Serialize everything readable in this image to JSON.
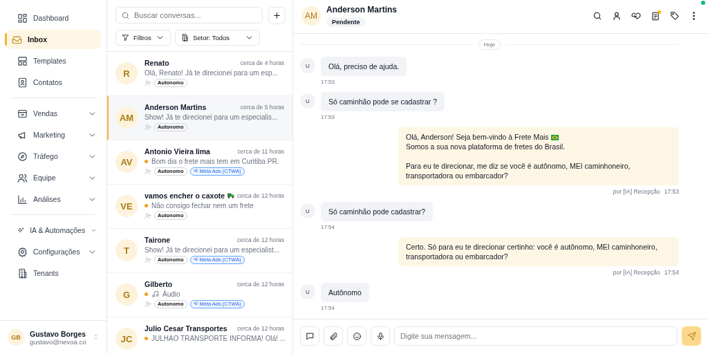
{
  "sidebar": {
    "groups": [
      [
        {
          "label": "Dashboard",
          "expandable": false,
          "selected": false
        },
        {
          "label": "Inbox",
          "expandable": false,
          "selected": true
        },
        {
          "label": "Templates",
          "expandable": false,
          "selected": false
        },
        {
          "label": "Contatos",
          "expandable": false,
          "selected": false
        }
      ],
      [
        {
          "label": "Vendas",
          "expandable": true,
          "selected": false
        },
        {
          "label": "Marketing",
          "expandable": true,
          "selected": false
        },
        {
          "label": "Tráfego",
          "expandable": true,
          "selected": false
        },
        {
          "label": "Equipe",
          "expandable": true,
          "selected": false
        },
        {
          "label": "Análises",
          "expandable": true,
          "selected": false
        }
      ],
      [
        {
          "label": "IA & Automações",
          "expandable": true,
          "selected": false
        },
        {
          "label": "Configurações",
          "expandable": true,
          "selected": false
        },
        {
          "label": "Tenants",
          "expandable": false,
          "selected": false
        }
      ]
    ],
    "user": {
      "initials": "GB",
      "name": "Gustavo Borges",
      "email": "gustavo@nevoa.co"
    }
  },
  "conversations_panel": {
    "search": {
      "placeholder": "Buscar conversas..."
    },
    "filters": [
      "Filtros",
      "Setor: Todos"
    ],
    "conversations": [
      {
        "initials": "R",
        "name": "Renato",
        "time": "cerca de 4 horas",
        "preview": "Olá, Renato! Já te direcionei para um esp...",
        "unread": false,
        "kind": "text",
        "selected": false,
        "tags": [
          {
            "label": "Autonomo",
            "kind": "plain"
          }
        ]
      },
      {
        "initials": "AM",
        "name": "Anderson Martins",
        "time": "cerca de 5 horas",
        "preview": "Show! Já te direcionei para um especialis...",
        "unread": false,
        "kind": "text",
        "selected": true,
        "tags": [
          {
            "label": "Autonomo",
            "kind": "plain"
          }
        ]
      },
      {
        "initials": "AV",
        "name": "Antonio Vieira lima",
        "time": "cerca de 11 horas",
        "preview": "Bom dia o frete mais tem em Curitiba PR.",
        "unread": true,
        "kind": "text",
        "selected": false,
        "tags": [
          {
            "label": "Autonomo",
            "kind": "plain"
          },
          {
            "label": "Meta Ads (CTWA)",
            "kind": "ads"
          }
        ]
      },
      {
        "initials": "VE",
        "name": "vamos encher o caxote",
        "time": "cerca de 12 horas",
        "preview": "Não consigo fechar nem um frete",
        "unread": true,
        "kind": "text",
        "selected": false,
        "tags": [
          {
            "label": "Autonomo",
            "kind": "plain"
          }
        ]
      },
      {
        "initials": "T",
        "name": "Tairone",
        "time": "cerca de 12 horas",
        "preview": "Show! Já te direcionei para um especialist...",
        "unread": false,
        "kind": "text",
        "selected": false,
        "tags": [
          {
            "label": "Autonomo",
            "kind": "plain"
          },
          {
            "label": "Meta Ads (CTWA)",
            "kind": "ads"
          }
        ]
      },
      {
        "initials": "G",
        "name": "Gilberto",
        "time": "cerca de 12 horas",
        "preview": "Áudio",
        "unread": true,
        "kind": "audio",
        "selected": false,
        "tags": [
          {
            "label": "Autonomo",
            "kind": "plain"
          },
          {
            "label": "Meta Ads (CTWA)",
            "kind": "ads"
          }
        ]
      },
      {
        "initials": "JC",
        "name": "Julio Cesar Transportes",
        "time": "cerca de 12 horas",
        "preview": "JULHAO TRANSPORTE INFORMA! Olá! ...",
        "unread": true,
        "kind": "text",
        "selected": false
      }
    ]
  },
  "chat": {
    "contact": {
      "initials": "AM",
      "name": "Anderson Martins",
      "status": "Pendente"
    },
    "date_divider": "Hoje",
    "messages": [
      {
        "kind": "in",
        "avatar": "U",
        "text": "Olá, preciso de ajuda.",
        "time": "17:53"
      },
      {
        "kind": "in",
        "avatar": "U",
        "text": "Só caminhão pode se cadastrar ?",
        "time": "17:53"
      },
      {
        "kind": "out",
        "text": "Olá, Anderson! Seja bem-vindo à Frete Mais\nSomos a sua nova plataforma de fretes do Brasil.\n\nPara eu te direcionar, me diz se você é autônomo, MEI caminhoneiro,\ntransportadora ou embarcador?",
        "author": "por [IA] Recepção",
        "time": "17:53"
      },
      {
        "kind": "in",
        "avatar": "U",
        "text": "Só caminhão pode cadastrar?",
        "time": "17:54"
      },
      {
        "kind": "out",
        "text": "Certo. Só para eu te direcionar certinho: você é autônomo, MEI caminhoneiro,\ntransportadora ou embarcador?",
        "author": "por [IA] Recepção",
        "time": "17:54"
      },
      {
        "kind": "in",
        "avatar": "U",
        "text": "Autônomo",
        "time": "17:54"
      }
    ],
    "composer": {
      "placeholder": "Digite sua mensagem..."
    }
  }
}
